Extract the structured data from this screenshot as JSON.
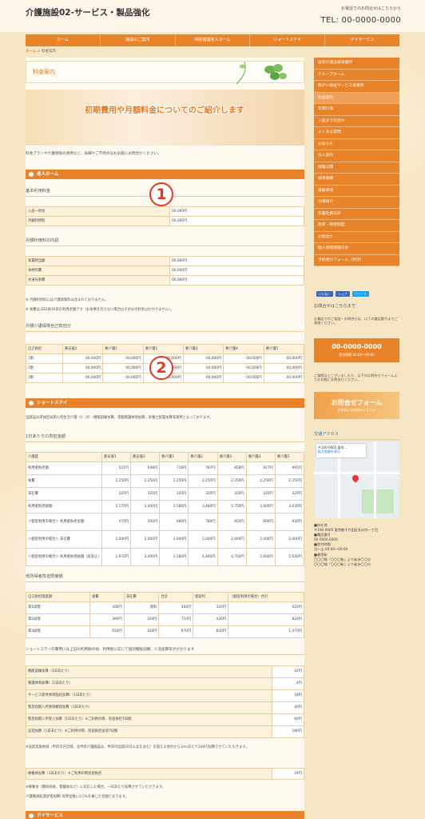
{
  "header": {
    "title": "介護施設02-サービス・製品強化",
    "contact_caption": "お電話でのお問合せはこちらから",
    "tel": "TEL: 00-0000-0000"
  },
  "nav": [
    "ホーム",
    "施設のご案内",
    "特別養護老人ホーム",
    "ショートステイ",
    "デイサービス"
  ],
  "breadcrumb": {
    "home": "ホーム",
    "current": "料金案内"
  },
  "page_title": "料金案内",
  "hero_text": "初期費用や月額料金についてのご紹介します",
  "intro": "料金プランや介護保険の適用など、詳細やご不明点はお気軽にお問合せください。",
  "nursing_home": {
    "section": "老人ホーム",
    "basic_heading": "基本利用料金",
    "basic_rows": [
      [
        "入居一時金",
        "00,000円"
      ],
      [
        "月額利用料",
        "00,000円"
      ]
    ],
    "monthly_heading": "月額利用料の内訳",
    "monthly_rows": [
      [
        "家賃相当額",
        "00,000円"
      ],
      [
        "食材料費",
        "00,000円"
      ],
      [
        "水道光熱費",
        "00,000円"
      ]
    ],
    "note1": "※ 月額利用料には介護保険料は含まれておりません。",
    "note2": "※ 食費は1日3食30日の利用金額です（お食事を召さない場合はその分の料金はかかりません）。",
    "care_heading": "月額介護保険自己負担分",
    "care_header": [
      "自己負担",
      "要支援2",
      "要介護1",
      "要介護2",
      "要介護3",
      "要介護4",
      "要介護5"
    ],
    "care_rows": [
      [
        "1割",
        "00,000円",
        "00,000円",
        "00,000円",
        "00,000円",
        "00,000円",
        "00,000円"
      ],
      [
        "2割",
        "00,000円",
        "00,000円",
        "00,000円",
        "00,000円",
        "00,000円",
        "00,000円"
      ],
      [
        "3割",
        "00,000円",
        "00,000円",
        "00,000円",
        "00,000円",
        "00,000円",
        "00,000円"
      ]
    ]
  },
  "shortstay": {
    "section": "ショートステイ",
    "intro": "当施設は単独型短期入所生活介護（Ⅰ）（Ⅱ）・機能訓練加算、夜勤看護体制加算、栄養士配置加算等適用となっております。",
    "daily_heading": "1日あたりの負担金額",
    "daily_header": [
      "介護度",
      "要支援1",
      "要支援2",
      "要介護1",
      "要介護2",
      "要介護3",
      "要介護4",
      "要介護5"
    ],
    "daily_rows": [
      [
        "利用者負担額",
        "521円",
        "648円",
        "718円",
        "787円",
        "858円",
        "927円",
        "995円"
      ],
      [
        "食費",
        "2,250円",
        "2,250円",
        "2,250円",
        "2,250円",
        "2,250円",
        "2,250円",
        "2,250円"
      ],
      [
        "滞在費",
        "320円",
        "320円",
        "320円",
        "320円",
        "320円",
        "320円",
        "320円"
      ],
      [
        "利用者負担総額",
        "3,170円",
        "3,400円",
        "3,580円",
        "3,480円",
        "3,750円",
        "3,600円",
        "3,630円"
      ],
      [
        "＜個室利用の場合＞ 利用者負担金額",
        "470円",
        "500円",
        "680円",
        "780円",
        "850円",
        "900円",
        "930円"
      ],
      [
        "＜個室利用の場合＞ 滞在費",
        "2,000円",
        "2,000円",
        "2,000円",
        "2,000円",
        "2,000円",
        "2,000円",
        "2,000円"
      ],
      [
        "＜個室利用の場合＞ 利用者負担総額（居室込）",
        "2,970円",
        "3,400円",
        "3,580円",
        "4,460円",
        "4,750円",
        "5,600円",
        "5,630円"
      ]
    ],
    "low_heading": "低所得者負担限度額",
    "low_header": [
      "自己負担限度額",
      "食費",
      "滞在費",
      "合計",
      "個室料",
      "（個室利用の場合）合計"
    ],
    "low_rows": [
      [
        "第1段階",
        "300円",
        "無料",
        "300円",
        "320円",
        "620円"
      ],
      [
        "第2段階",
        "390円",
        "320円",
        "710円",
        "420円",
        "820円"
      ],
      [
        "第3段階",
        "650円",
        "320円",
        "970円",
        "820円",
        "1,470円"
      ]
    ],
    "extra_heading": "ショートステイの費用には上記の利用額の他、利用者に応じて個別機能訓練、入浴加算等がかかります",
    "extra_rows": [
      [
        "機能訓練加算（1日あたり）",
        "42円"
      ],
      [
        "看護体制加算Ⅰ（1日あたり）",
        "4円"
      ],
      [
        "サービス提供体制強化加算Ⅰ（1日あたり）",
        "18円"
      ],
      [
        "緊急短期入所体制確保加算（1日あたり）",
        "40円"
      ],
      [
        "緊急短期入所受入加算（1日あたり）※ご利用の際、別途負担7日間",
        "60円"
      ],
      [
        "送迎加算（1日あたり）※ご利用の際、別途負担送迎7日間",
        "180円"
      ]
    ],
    "note3": "※送迎実施地域（甲府市内全域、北甲府介護施設は、甲府市国道20号以北を含む）を越える地点から1kmあたり240円加算させていただきます。",
    "bath_rows": [
      [
        "療養食加算（1日あたり）※ご利用の際別途負担",
        "24円"
      ]
    ],
    "note4": "※療養食（糖尿病食、腎臓食など）に対応した場合、一日あたり加算させていただきます。",
    "note5": "介護職員処遇改善加算Ⅰ 尚単位数に2.5%を乗じた金額となります。"
  },
  "next_section": "デイサービス",
  "markers": [
    "1",
    "2"
  ],
  "sidebar": {
    "menu": [
      "居宅介護支援事業所",
      "グループホーム",
      "障がい福祉サービス事業所",
      "料金案内",
      "年間行事",
      "入居までの流れ",
      "よくある質問",
      "お知らせ",
      "法人案内",
      "情報公開",
      "採用情報",
      "募集事項",
      "仕事紹介",
      "先輩社員の声",
      "教育・研修制度",
      "お問合せ",
      "個人情報保護方針",
      "予約受付フォーム（共済）"
    ],
    "active_index": 3,
    "fb_like": "いいね！",
    "fb_share": "シェア",
    "tw": "ツイート",
    "contact_heading": "お問合せはこちらまで",
    "contact_text": "お電話でのご相談・お問合せは、以下の電話番号までご連絡ください。",
    "tel": "00-0000-0000",
    "hours": "受付時間 00:00〜00:00",
    "form_text": "ご質問などございましたら、以下のお問合せフォームよりお気軽にお問合せください。",
    "form_title": "お問合せフォーム",
    "form_sub": "お気軽にお問合せください",
    "access_heading": "交通アクセス",
    "map_label": "〒100-0005 東京...",
    "map_label2": "拡大地図を表示",
    "addr_label": "■所在地",
    "addr": "〒100-0005 東京都千代田区丸の内一丁目",
    "tel_label": "■電話番号",
    "tel2": "00-0000-0000",
    "hours_label": "■受付時間",
    "hours2": "月〜土 00:00〜00:00",
    "station_label": "■最寄駅",
    "station1": "〇〇〇線「〇〇〇駅」より徒歩〇〇分",
    "station2": "〇〇〇線「〇〇〇駅」より徒歩〇〇分"
  }
}
